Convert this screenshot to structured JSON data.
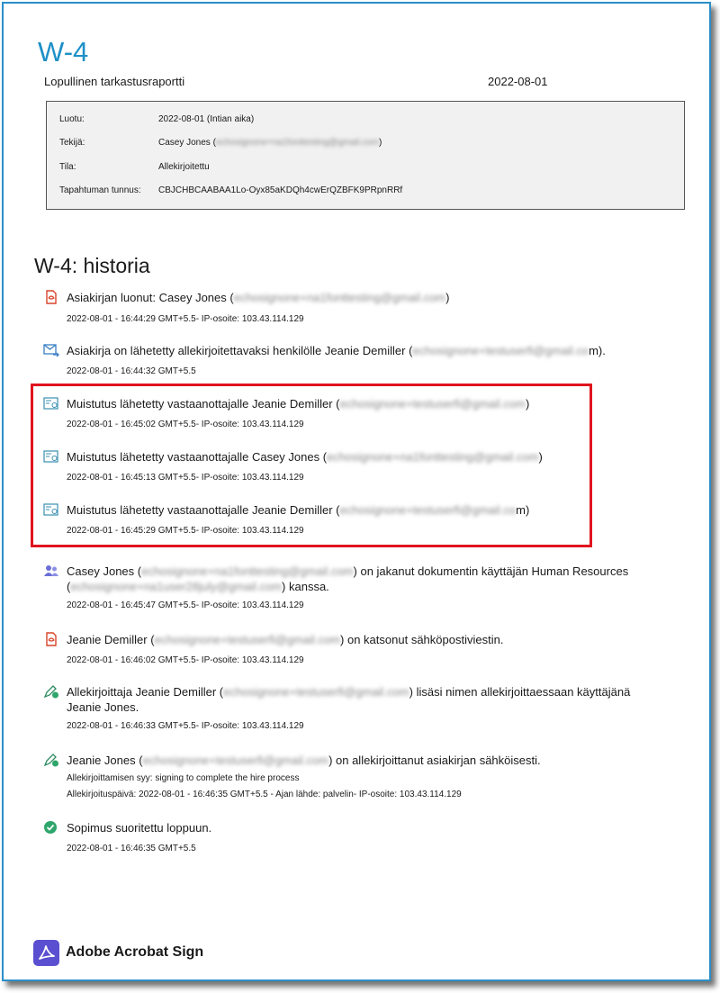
{
  "document": {
    "title": "W-4",
    "subtitle": "Lopullinen tarkastusraportti",
    "report_date": "2022-08-01"
  },
  "info": {
    "created_label": "Luotu:",
    "created_value": "2022-08-01 (Intian aika)",
    "author_label": "Tekijä:",
    "author_name": "Casey Jones (",
    "author_email": "echosignone+na1fonttesting@gmail.com",
    "author_close": ")",
    "status_label": "Tila:",
    "status_value": "Allekirjoitettu",
    "transaction_label": "Tapahtuman tunnus:",
    "transaction_value": "CBJCHBCAABAA1Lo-Oyx85aKDQh4cwErQZBFK9PRpnRRf"
  },
  "history": {
    "title": "W-4: historia",
    "events": [
      {
        "icon": "document-created-icon",
        "text_a": "Asiakirjan luonut: Casey Jones (",
        "email": "echosignone+na1fonttesting@gmail.com",
        "text_b": ")",
        "meta1": "2022-08-01 - 16:44:29 GMT+5.5- IP-osoite: 103.43.114.129"
      },
      {
        "icon": "email-sent-icon",
        "text_a": "Asiakirja on lähetetty allekirjoitettavaksi henkilölle Jeanie Demiller (",
        "email": "echosignone+testuserfi@gmail.co",
        "text_b": "m).",
        "meta1": "2022-08-01 - 16:44:32 GMT+5.5"
      },
      {
        "icon": "reminder-icon",
        "text_a": "Muistutus lähetetty vastaanottajalle Jeanie Demiller (",
        "email": "echosignone+testuserfi@gmail.com",
        "text_b": ")",
        "meta1": "2022-08-01 - 16:45:02 GMT+5.5- IP-osoite: 103.43.114.129"
      },
      {
        "icon": "reminder-icon",
        "text_a": "Muistutus lähetetty vastaanottajalle Casey Jones (",
        "email": "echosignone+na1fonttesting@gmail.com",
        "text_b": ")",
        "meta1": "2022-08-01 - 16:45:13 GMT+5.5- IP-osoite: 103.43.114.129"
      },
      {
        "icon": "reminder-icon",
        "text_a": "Muistutus lähetetty vastaanottajalle Jeanie Demiller (",
        "email": "echosignone+testuserfi@gmail.co",
        "text_b": "m)",
        "meta1": "2022-08-01 - 16:45:29 GMT+5.5- IP-osoite: 103.43.114.129"
      },
      {
        "icon": "shared-users-icon",
        "text_a": "Casey Jones (",
        "email": "echosignone+na1fonttesting@gmail.com",
        "text_b": ") on jakanut dokumentin käyttäjän Human Resources",
        "text_c": "(",
        "email2": "echosignone+na1user28july@gmail.com",
        "text_d": ") kanssa.",
        "meta1": "2022-08-01 - 16:45:47 GMT+5.5- IP-osoite: 103.43.114.129"
      },
      {
        "icon": "document-viewed-icon",
        "text_a": "Jeanie Demiller (",
        "email": "echosignone+testuserfi@gmail.com",
        "text_b": ") on katsonut sähköpostiviestin.",
        "meta1": "2022-08-01 - 16:46:02 GMT+5.5- IP-osoite: 103.43.114.129"
      },
      {
        "icon": "signature-pen-icon",
        "text_a": "Allekirjoittaja Jeanie Demiller (",
        "email": "echosignone+testuserfi@gmail.com",
        "text_b": ") lisäsi nimen allekirjoittaessaan käyttäjänä",
        "text_c": "Jeanie Jones.",
        "meta1": "2022-08-01 - 16:46:33 GMT+5.5- IP-osoite: 103.43.114.129"
      },
      {
        "icon": "signature-pen-icon",
        "text_a": "Jeanie Jones (",
        "email": "echosignone+testuserfi@gmail.com",
        "text_b": ") on allekirjoittanut asiakirjan sähköisesti.",
        "meta1": "Allekirjoittamisen syy: signing to complete the hire process",
        "meta2": "Allekirjoituspäivä: 2022-08-01 - 16:46:35 GMT+5.5 - Ajan lähde: palvelin- IP-osoite: 103.43.114.129"
      },
      {
        "icon": "check-circle-icon",
        "text_a": "Sopimus suoritettu loppuun.",
        "meta1": "2022-08-01 - 16:46:35 GMT+5.5"
      }
    ]
  },
  "footer": {
    "brand": "Adobe Acrobat Sign",
    "logo_icon": "adobe-acrobat-logo-icon"
  },
  "colors": {
    "title_blue": "#1e90c8",
    "frame_blue": "#2b8fc9",
    "highlight_red": "#e0141e",
    "reminder_teal": "#3a8fb0",
    "check_green": "#2ea66b",
    "user_purple": "#6a6fd8",
    "doc_red": "#d9442b"
  }
}
